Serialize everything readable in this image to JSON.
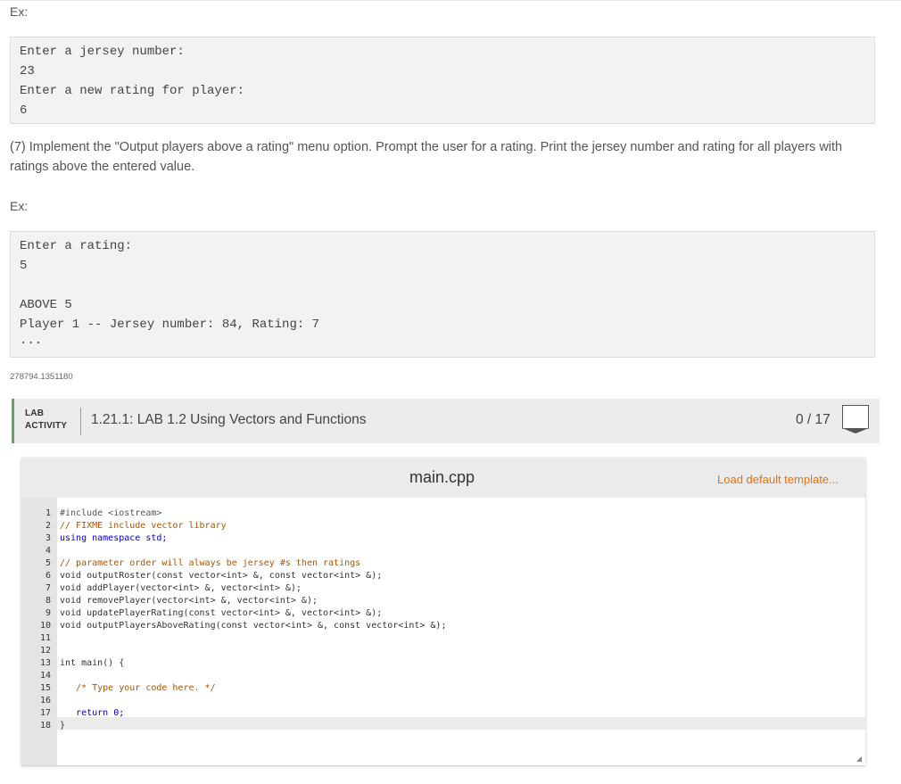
{
  "examples": {
    "ex1_label": "Ex:",
    "ex1_lines": [
      "Enter a jersey number:",
      "23",
      "Enter a new rating for player:",
      "6"
    ],
    "paragraph": "(7) Implement the \"Output players above a rating\" menu option. Prompt the user for a rating. Print the jersey number and rating for all players with ratings above the entered value.",
    "ex2_label": "Ex:",
    "ex2_lines": [
      "Enter a rating:",
      "5",
      "",
      "ABOVE 5",
      "Player 1 -- Jersey number: 84, Rating: 7",
      "..."
    ]
  },
  "activity_id": "278794.1351180",
  "lab": {
    "label_line1": "LAB",
    "label_line2": "ACTIVITY",
    "title": "1.21.1: LAB 1.2 Using Vectors and Functions",
    "score": "0 / 17",
    "accent_color": "#5aa95a"
  },
  "editor": {
    "filename": "main.cpp",
    "load_default": "Load default template...",
    "line_numbers": [
      "1",
      "2",
      "3",
      "4",
      "5",
      "6",
      "7",
      "8",
      "9",
      "10",
      "11",
      "12",
      "13",
      "14",
      "15",
      "16",
      "17",
      "18"
    ],
    "code_lines": [
      "#include <iostream>",
      "// FIXME include vector library",
      "using namespace std;",
      "",
      "// parameter order will always be jersey #s then ratings",
      "void outputRoster(const vector<int> &, const vector<int> &);",
      "void addPlayer(vector<int> &, vector<int> &);",
      "void removePlayer(vector<int> &, vector<int> &);",
      "void updatePlayerRating(const vector<int> &, vector<int> &);",
      "void outputPlayersAboveRating(const vector<int> &, const vector<int> &);",
      "",
      "",
      "int main() {",
      "",
      "   /* Type your code here. */",
      "",
      "   return 0;",
      "}"
    ]
  }
}
